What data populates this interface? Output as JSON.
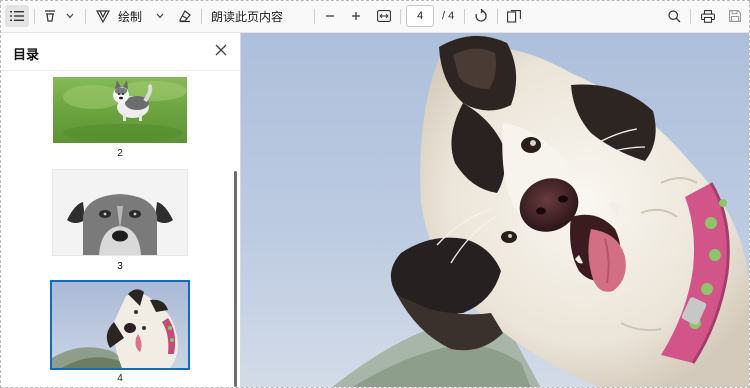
{
  "toolbar": {
    "draw_label": "绘制",
    "read_aloud_label": "朗读此页内容",
    "current_page": "4",
    "page_total": "/ 4"
  },
  "sidebar": {
    "title": "目录",
    "thumbnails": [
      {
        "number": "2",
        "selected": false
      },
      {
        "number": "3",
        "selected": false
      },
      {
        "number": "4",
        "selected": true
      }
    ]
  },
  "colors": {
    "accent": "#0f6cbd",
    "toolbar_bg": "#f9f9f9",
    "sky": "#b9cbe3"
  }
}
